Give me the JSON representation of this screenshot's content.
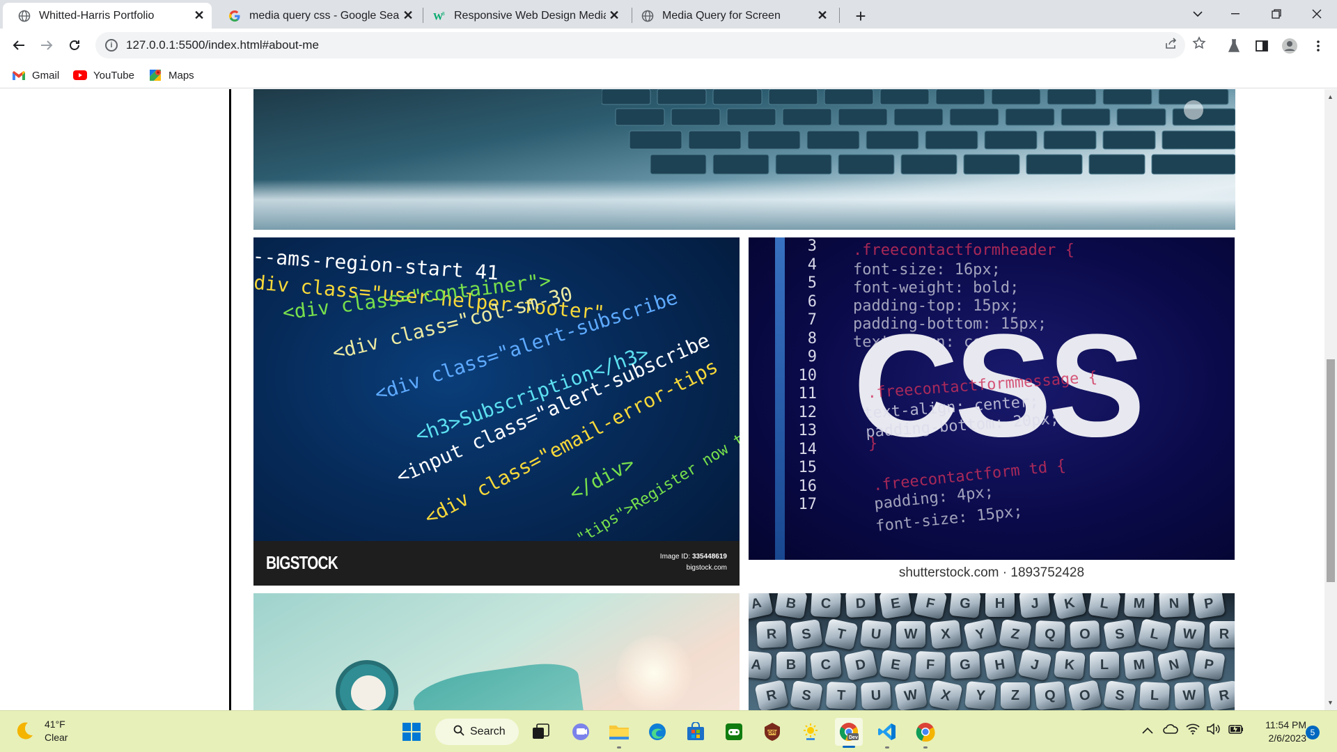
{
  "browser": {
    "tabs": [
      {
        "label": "Whitted-Harris Portfolio",
        "active": true,
        "icon": "globe-icon"
      },
      {
        "label": "media query css - Google Search",
        "active": false,
        "icon": "google-icon"
      },
      {
        "label": "Responsive Web Design Media Q",
        "active": false,
        "icon": "w3schools-icon"
      },
      {
        "label": "Media Query for Screen",
        "active": false,
        "icon": "globe-icon"
      }
    ],
    "url": "127.0.0.1:5500/index.html#about-me",
    "bookmarks": [
      {
        "label": "Gmail",
        "icon": "gmail-icon"
      },
      {
        "label": "YouTube",
        "icon": "youtube-icon"
      },
      {
        "label": "Maps",
        "icon": "maps-icon"
      }
    ]
  },
  "page": {
    "images": [
      {
        "name": "laptop-keyboard-image",
        "alt": "Laptop keyboard"
      },
      {
        "name": "html-code-image",
        "brand": "BIGSTOCK",
        "image_id_label": "Image ID:",
        "image_id": "335448619",
        "site": "bigstock.com",
        "code_lines": [
          "--ams-region-start 41",
          "div class=\"user-helper-footer\"",
          "<div class=\"container\">",
          "<div class=\"col-sm-30",
          "<div class=\"alert-subscribe",
          "<h3>Subscription</h3>",
          "<input class=\"alert-subscribe",
          "<div class=\"email-error-tips",
          "</div>",
          "\"tips\">Register now to get"
        ]
      },
      {
        "name": "css-image",
        "big_text": "CSS",
        "caption": "shutterstock.com · 1893752428",
        "line_numbers": [
          "3",
          "4",
          "5",
          "6",
          "7",
          "8",
          "9",
          "10",
          "11",
          "12",
          "13",
          "14",
          "15",
          "16",
          "17"
        ],
        "code_lines": [
          ".freecontactformheader {",
          "font-size: 16px;",
          "font-weight: bold;",
          "padding-top: 15px;",
          "padding-bottom: 15px;",
          "text-align: center;",
          ".freecontactformmessage {",
          "text-align: center;",
          "padding-bottom: 20px;",
          "}",
          ".freecontactform td {",
          "padding: 4px;",
          "font-size: 15px;"
        ]
      },
      {
        "name": "alarm-clock-image",
        "alt": "Alarm clock"
      },
      {
        "name": "letter-beads-image",
        "letters": [
          "A",
          "B",
          "C",
          "D",
          "E",
          "F",
          "G",
          "H",
          "J",
          "K",
          "L",
          "M",
          "N",
          "P",
          "R",
          "S",
          "T",
          "U",
          "W",
          "X",
          "Y",
          "Z",
          "Q",
          "O",
          "S",
          "L",
          "W",
          "R"
        ]
      }
    ]
  },
  "taskbar": {
    "weather": {
      "temp": "41°F",
      "condition": "Clear"
    },
    "search_label": "Search",
    "time": "11:54 PM",
    "date": "2/6/2023",
    "notification_count": "5"
  }
}
